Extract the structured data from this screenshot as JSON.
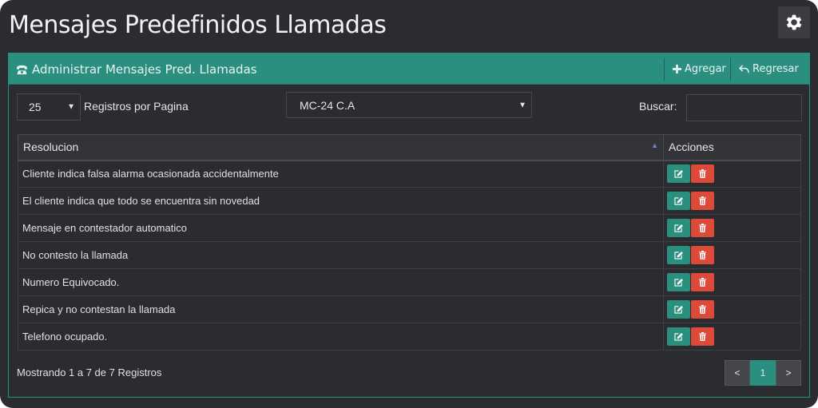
{
  "page": {
    "title": "Mensajes Predefinidos Llamadas"
  },
  "settings": {
    "icon": "gear-icon"
  },
  "panel": {
    "title": "Administrar Mensajes Pred. Llamadas",
    "title_icon": "phone-icon",
    "add_label": "Agregar",
    "back_label": "Regresar"
  },
  "controls": {
    "page_size": "25",
    "page_size_label": "Registros por Pagina",
    "company": "MC-24 C.A",
    "search_label": "Buscar:",
    "search_value": ""
  },
  "table": {
    "columns": [
      "Resolucion",
      "Acciones"
    ],
    "rows": [
      "Cliente indica falsa alarma ocasionada accidentalmente",
      "El cliente indica que todo se encuentra sin novedad",
      "Mensaje en contestador automatico",
      "No contesto la llamada",
      "Numero Equivocado.",
      "Repica y no contestan la llamada",
      "Telefono ocupado."
    ]
  },
  "footer": {
    "info": "Mostrando 1 a 7 de 7 Registros",
    "prev": "<",
    "page": "1",
    "next": ">"
  },
  "colors": {
    "accent": "#2a8f7f",
    "danger": "#de4a3a",
    "background": "#2b2c30"
  }
}
